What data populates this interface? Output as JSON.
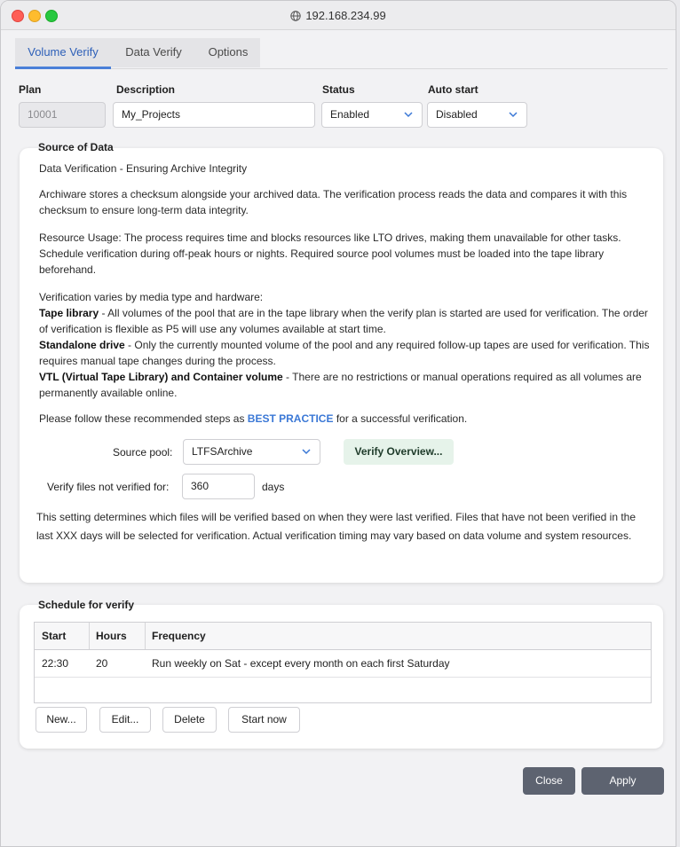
{
  "window": {
    "title": "192.168.234.99"
  },
  "tabs": [
    {
      "label": "Volume Verify"
    },
    {
      "label": "Data Verify"
    },
    {
      "label": "Options"
    }
  ],
  "form": {
    "plan_label": "Plan",
    "plan_value": "10001",
    "description_label": "Description",
    "description_value": "My_Projects",
    "status_label": "Status",
    "status_value": "Enabled",
    "autostart_label": "Auto start",
    "autostart_value": "Disabled"
  },
  "source": {
    "group_title": "Source of Data",
    "heading": "Data Verification - Ensuring Archive Integrity",
    "p1": "Archiware stores a checksum alongside your archived data. The verification process reads the data and compares it with this checksum to ensure long-term data integrity.",
    "p2": "Resource Usage: The process requires time and blocks resources like LTO drives, making them unavailable for other tasks. Schedule verification during off-peak hours or nights. Required source pool volumes must be loaded into the tape library beforehand.",
    "p3_intro": "Verification varies by media type and hardware:",
    "p3_tape_bold": "Tape library",
    "p3_tape_text": " - All volumes of the pool that are in the tape library when the verify plan is started are used for verification. The order of verification is flexible as P5 will use any volumes available at start time.",
    "p3_standalone_bold": "Standalone drive",
    "p3_standalone_text": " - Only the currently mounted volume of the pool and any required follow-up tapes are used for verification. This requires manual tape changes during the process.",
    "p3_vtl_bold": "VTL (Virtual Tape Library) and Container volume",
    "p3_vtl_text": " - There are no restrictions or manual operations required as all volumes are permanently available online.",
    "p4_prefix": "Please follow these recommended steps as ",
    "p4_link": "BEST PRACTICE",
    "p4_suffix": " for a successful verification.",
    "pool_label": "Source pool:",
    "pool_value": "LTFSArchive",
    "overview_button": "Verify Overview...",
    "days_label": "Verify files not verified for:",
    "days_value": "360",
    "days_unit": "days",
    "note": "This setting determines which files will be verified based on when they were last verified. Files that have not been verified in the last XXX days will be selected for verification. Actual verification timing may vary based on data volume and system resources."
  },
  "schedule": {
    "group_title": "Schedule for verify",
    "columns": [
      "Start",
      "Hours",
      "Frequency"
    ],
    "rows": [
      {
        "start": "22:30",
        "hours": "20",
        "frequency": "Run weekly on Sat - except every month on each first Saturday"
      }
    ],
    "buttons": {
      "new": "New...",
      "edit": "Edit...",
      "delete": "Delete",
      "start_now": "Start now"
    }
  },
  "footer": {
    "close": "Close",
    "apply": "Apply"
  },
  "colors": {
    "accent": "#4a7fd8",
    "best_practice": "#3b78d6",
    "primary_button": "#5d6370",
    "green_button": "#e6f3ea"
  }
}
